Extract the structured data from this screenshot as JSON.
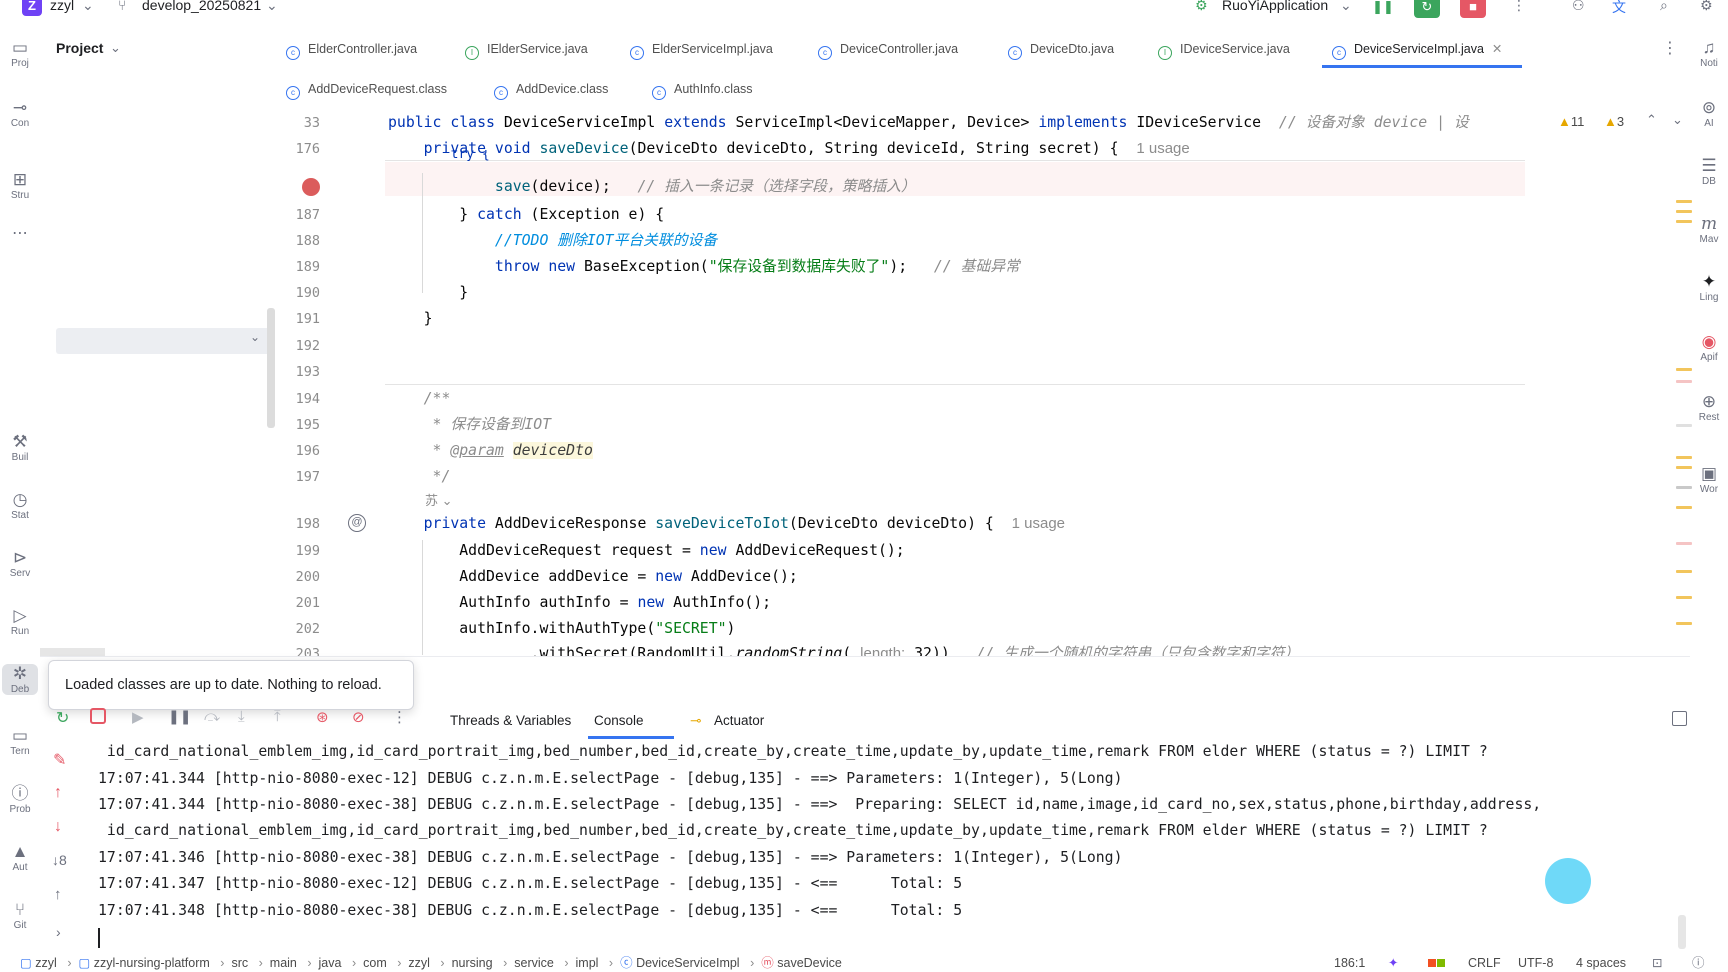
{
  "titlebar": {
    "project_badge": "Z",
    "project_name": "zzyl",
    "branch_icon": "branch-icon",
    "branch": "develop_20250821",
    "run_config": "RuoYiApplication"
  },
  "left_toolbar": [
    {
      "label": "Proj",
      "icon": "folder-icon"
    },
    {
      "label": "Con",
      "icon": "commit-icon"
    },
    {
      "label": "Stru",
      "icon": "structure-icon"
    },
    {
      "label": "Buil",
      "icon": "build-icon"
    },
    {
      "label": "Stat",
      "icon": "stats-icon"
    },
    {
      "label": "Serv",
      "icon": "services-icon"
    },
    {
      "label": "Run",
      "icon": "run-icon"
    },
    {
      "label": "Deb",
      "icon": "debug-icon"
    },
    {
      "label": "Tern",
      "icon": "terminal-icon"
    },
    {
      "label": "Prob",
      "icon": "problems-icon"
    },
    {
      "label": "Aut",
      "icon": "autobuild-icon"
    },
    {
      "label": "Git",
      "icon": "git-icon"
    }
  ],
  "right_toolbar": [
    {
      "label": "Noti",
      "icon": "bell-icon"
    },
    {
      "label": "AI",
      "icon": "ai-icon"
    },
    {
      "label": "DB",
      "icon": "database-icon"
    },
    {
      "label": "Mav",
      "icon": "maven-icon"
    },
    {
      "label": "Ling",
      "icon": "lingma-icon"
    },
    {
      "label": "Apif",
      "icon": "apifox-icon"
    },
    {
      "label": "Rest",
      "icon": "globe-icon"
    },
    {
      "label": "Wor",
      "icon": "word-icon"
    }
  ],
  "project_panel": {
    "title": "Project"
  },
  "tabs_row1": [
    {
      "label": "ElderController.java",
      "kind": "c"
    },
    {
      "label": "IElderService.java",
      "kind": "i"
    },
    {
      "label": "ElderServiceImpl.java",
      "kind": "c"
    },
    {
      "label": "DeviceController.java",
      "kind": "c"
    },
    {
      "label": "DeviceDto.java",
      "kind": "c"
    },
    {
      "label": "IDeviceService.java",
      "kind": "i"
    },
    {
      "label": "DeviceServiceImpl.java",
      "kind": "c",
      "active": true
    }
  ],
  "tabs_row2": [
    {
      "label": "AddDeviceRequest.class",
      "kind": "c"
    },
    {
      "label": "AddDevice.class",
      "kind": "c"
    },
    {
      "label": "AuthInfo.class",
      "kind": "c"
    }
  ],
  "inspections": {
    "warnings": "11",
    "weak_warnings": "3"
  },
  "editor": {
    "sticky": [
      {
        "line": "33",
        "text": "public class DeviceServiceImpl extends ServiceImpl<DeviceMapper, Device> implements IDeviceService",
        "comment": "// 设备对象 device | 设"
      },
      {
        "line": "176",
        "text": "    private void saveDevice(DeviceDto deviceDto, String deviceId, String secret) {",
        "hint": "1 usage"
      }
    ],
    "lines": [
      {
        "line": "",
        "code": "            save(device);",
        "comment": "// 插入一条记录（选择字段，策略插入）"
      },
      {
        "line": "187",
        "code": "        } catch (Exception e) {"
      },
      {
        "line": "188",
        "code": "            //TODO 删除IOT平台关联的设备"
      },
      {
        "line": "189",
        "code": "            throw new BaseException(\"保存设备到数据库失败了\");",
        "comment": "// 基础异常"
      },
      {
        "line": "190",
        "code": "        }"
      },
      {
        "line": "191",
        "code": "    }"
      },
      {
        "line": "192",
        "code": ""
      },
      {
        "line": "193",
        "code": ""
      },
      {
        "line": "194",
        "code": "    /**"
      },
      {
        "line": "195",
        "code": "     * 保存设备到IOT"
      },
      {
        "line": "196",
        "code": "     * @param deviceDto"
      },
      {
        "line": "197",
        "code": "     */"
      },
      {
        "line": "198",
        "code": "    private AddDeviceResponse saveDeviceToIot(DeviceDto deviceDto) {",
        "hint": "1 usage"
      },
      {
        "line": "199",
        "code": "        AddDeviceRequest request = new AddDeviceRequest();"
      },
      {
        "line": "200",
        "code": "        AddDevice addDevice = new AddDevice();"
      },
      {
        "line": "201",
        "code": "        AuthInfo authInfo = new AuthInfo();"
      },
      {
        "line": "202",
        "code": "        authInfo.withAuthType(\"SECRET\")"
      },
      {
        "line": "203",
        "code": "                .withSecret(RandomUtil.randomString( length: 32))",
        "comment": "// 生成一个随机的字符串（只包含数字和字符）"
      }
    ],
    "author_mark": "苏"
  },
  "notification": {
    "text": "Loaded classes are up to date. Nothing to reload."
  },
  "debug_tabs": {
    "threads": "Threads & Variables",
    "console": "Console",
    "actuator": "Actuator"
  },
  "console": [
    " id_card_national_emblem_img,id_card_portrait_img,bed_number,bed_id,create_by,create_time,update_by,update_time,remark FROM elder WHERE (status = ?) LIMIT ?",
    "17:07:41.344 [http-nio-8080-exec-12] DEBUG c.z.n.m.E.selectPage - [debug,135] - ==> Parameters: 1(Integer), 5(Long)",
    "17:07:41.344 [http-nio-8080-exec-38] DEBUG c.z.n.m.E.selectPage - [debug,135] - ==>  Preparing: SELECT id,name,image,id_card_no,sex,status,phone,birthday,address,",
    " id_card_national_emblem_img,id_card_portrait_img,bed_number,bed_id,create_by,create_time,update_by,update_time,remark FROM elder WHERE (status = ?) LIMIT ?",
    "17:07:41.346 [http-nio-8080-exec-38] DEBUG c.z.n.m.E.selectPage - [debug,135] - ==> Parameters: 1(Integer), 5(Long)",
    "17:07:41.347 [http-nio-8080-exec-12] DEBUG c.z.n.m.E.selectPage - [debug,135] - <==      Total: 5",
    "17:07:41.348 [http-nio-8080-exec-38] DEBUG c.z.n.m.E.selectPage - [debug,135] - <==      Total: 5"
  ],
  "breadcrumb": [
    "zzyl",
    "zzyl-nursing-platform",
    "src",
    "main",
    "java",
    "com",
    "zzyl",
    "nursing",
    "service",
    "impl",
    "DeviceServiceImpl",
    "saveDevice"
  ],
  "status": {
    "position": "186:1",
    "line_sep": "CRLF",
    "encoding": "UTF-8",
    "indent": "4 spaces"
  },
  "colors": {
    "accent": "#3574f0",
    "run_green": "#3ba55d",
    "stop_red": "#e55765",
    "badge_purple": "#6f42f5"
  }
}
